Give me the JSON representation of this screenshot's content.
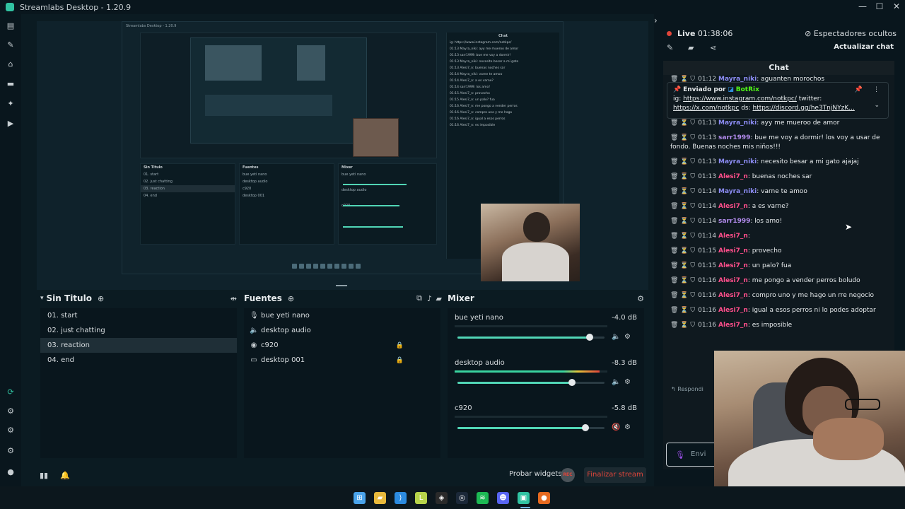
{
  "window": {
    "title": "Streamlabs Desktop - 1.20.9",
    "controls": [
      "—",
      "☐",
      "✕"
    ]
  },
  "scenes": {
    "title": "Sin Titulo",
    "items": [
      {
        "label": "01. start"
      },
      {
        "label": "02. just chatting"
      },
      {
        "label": "03. reaction",
        "active": true
      },
      {
        "label": "04. end"
      }
    ]
  },
  "sources": {
    "title": "Fuentes",
    "items": [
      {
        "label": "bue yeti nano",
        "icon": "mic-icon",
        "glyph": "🎙",
        "locked": false
      },
      {
        "label": "desktop audio",
        "icon": "speaker-icon",
        "glyph": "🔈",
        "locked": false
      },
      {
        "label": "c920",
        "icon": "webcam-icon",
        "glyph": "◉",
        "locked": true
      },
      {
        "label": "desktop 001",
        "icon": "monitor-icon",
        "glyph": "▭",
        "locked": true
      }
    ]
  },
  "mixer": {
    "title": "Mixer",
    "items": [
      {
        "name": "bue yeti nano",
        "db": "-4.0 dB",
        "level": 0.0,
        "volume": 0.9,
        "muted": false
      },
      {
        "name": "desktop audio",
        "db": "-8.3 dB",
        "level": 0.95,
        "volume": 0.78,
        "muted": false
      },
      {
        "name": "c920",
        "db": "-5.8 dB",
        "level": 0.0,
        "volume": 0.87,
        "muted": true
      }
    ]
  },
  "footer": {
    "test_widgets": "Probar widgets",
    "rec_badge": "REC",
    "end_stream": "Finalizar stream"
  },
  "live": {
    "label": "Live",
    "time": "01:38:06",
    "hidden_viewers": "Espectadores ocultos",
    "refresh_chat": "Actualizar chat"
  },
  "chat": {
    "title": "Chat",
    "partial_top": {
      "time": "01:12",
      "user": "Mayra_niki",
      "text": ": aguanten morochos"
    },
    "pinned": {
      "header": "Enviado por",
      "bot": "BotRix",
      "line1_prefix": "ig:",
      "line1_link": "https://www.instagram.com/notkpc/",
      "line1_suffix": "twitter:",
      "line2_link": "https://x.com/notkpc",
      "line2_mid": "ds:",
      "line2_link2": "https://discord.gg/he3TnjNYzK..."
    },
    "messages": [
      {
        "time": "01:13",
        "user": "Mayra_niki",
        "color": "#8d8df5",
        "text": ": ayy me mueroo de amor"
      },
      {
        "time": "01:13",
        "user": "sarr1999",
        "color": "#b58df0",
        "text": ": bue me voy a dormir! los voy a usar de fondo. Buenas noches mis niños!!!"
      },
      {
        "time": "01:13",
        "user": "Mayra_niki",
        "color": "#8d8df5",
        "text": ": necesito besar a mi gato ajajaj"
      },
      {
        "time": "01:13",
        "user": "Alesi7_n",
        "color": "#ff4f8b",
        "text": ": buenas noches sar"
      },
      {
        "time": "01:14",
        "user": "Mayra_niki",
        "color": "#8d8df5",
        "text": ": varne te amoo"
      },
      {
        "time": "01:14",
        "user": "Alesi7_n",
        "color": "#ff4f8b",
        "text": ": a es varne?"
      },
      {
        "time": "01:14",
        "user": "sarr1999",
        "color": "#b58df0",
        "text": ": los amo!"
      },
      {
        "time": "01:14",
        "user": "Alesi7_n",
        "color": "#ff4f8b",
        "text": ":"
      },
      {
        "time": "01:15",
        "user": "Alesi7_n",
        "color": "#ff4f8b",
        "text": ": provecho"
      },
      {
        "time": "01:15",
        "user": "Alesi7_n",
        "color": "#ff4f8b",
        "text": ": un palo? fua"
      },
      {
        "time": "01:16",
        "user": "Alesi7_n",
        "color": "#ff4f8b",
        "text": ": me pongo a vender perros boludo"
      },
      {
        "time": "01:16",
        "user": "Alesi7_n",
        "color": "#ff4f8b",
        "text": ": compro uno y me hago un rre negocio"
      },
      {
        "time": "01:16",
        "user": "Alesi7_n",
        "color": "#ff4f8b",
        "text": ": igual a esos perros ni lo podes adoptar"
      },
      {
        "time": "01:16",
        "user": "Alesi7_n",
        "color": "#ff4f8b",
        "text": ": es imposible"
      }
    ],
    "reply_label": "Respondi",
    "input_placeholder": "Envi"
  },
  "taskbar": [
    {
      "name": "windows-start-icon",
      "glyph": "⊞",
      "color": "#4aa3ea"
    },
    {
      "name": "file-explorer-icon",
      "glyph": "▰",
      "color": "#e8b93c"
    },
    {
      "name": "vscode-icon",
      "glyph": "⟩",
      "color": "#2c8be0"
    },
    {
      "name": "live-server-icon",
      "glyph": "L",
      "color": "#b7d34a"
    },
    {
      "name": "capcut-icon",
      "glyph": "◈",
      "color": "#2a2a2a"
    },
    {
      "name": "steam-icon",
      "glyph": "◎",
      "color": "#1b2838"
    },
    {
      "name": "spotify-icon",
      "glyph": "≋",
      "color": "#1db954"
    },
    {
      "name": "discord-icon",
      "glyph": "☻",
      "color": "#5865f2"
    },
    {
      "name": "streamlabs-icon",
      "glyph": "▣",
      "color": "#31c3a2"
    },
    {
      "name": "firefox-icon",
      "glyph": "●",
      "color": "#e66a20"
    }
  ],
  "nested": {
    "title": "Streamlabs Desktop - 1.20.9",
    "scene_header": "Sin Titulo",
    "sources_header": "Fuentes",
    "mixer_header": "Mixer",
    "chat_header": "Chat",
    "scenes": [
      "01. start",
      "02. just chatting",
      "03. reaction",
      "04. end"
    ],
    "sources": [
      "bue yeti nano",
      "desktop audio",
      "c920",
      "desktop 001"
    ],
    "mixer": [
      "bue yeti nano",
      "desktop audio",
      "c920"
    ],
    "chat_lines": [
      "ig: https://www.instagram.com/notkpc/",
      "01:13 Mayra_niki: ayy me mueroo de amor",
      "01:13 sarr1999: bue me voy a dormir!",
      "01:13 Mayra_niki: necesito besar a mi gato",
      "01:13 Alesi7_n: buenas noches sar",
      "01:14 Mayra_niki: varne te amoo",
      "01:14 Alesi7_n: a es varne?",
      "01:14 sarr1999: los amo!",
      "01:15 Alesi7_n: provecho",
      "01:15 Alesi7_n: un palo? fua",
      "01:16 Alesi7_n: me pongo a vender perros",
      "01:16 Alesi7_n: compro uno y me hago",
      "01:16 Alesi7_n: igual a esos perros",
      "01:16 Alesi7_n: es imposible"
    ]
  }
}
